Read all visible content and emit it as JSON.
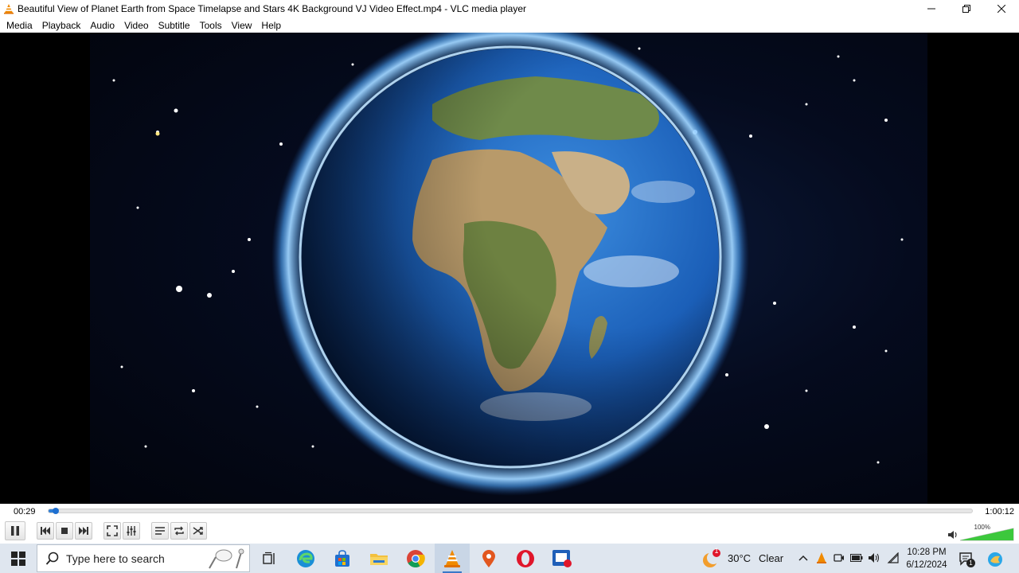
{
  "window": {
    "title": "Beautiful View of Planet Earth from Space Timelapse and Stars 4K Background VJ Video Effect.mp4 - VLC media player",
    "app_icon": "vlc-cone-icon",
    "controls": [
      "minimize-icon",
      "maximize-icon",
      "close-icon"
    ]
  },
  "menu": {
    "items": [
      "Media",
      "Playback",
      "Audio",
      "Video",
      "Subtitle",
      "Tools",
      "View",
      "Help"
    ]
  },
  "video": {
    "scene": "earth-from-space",
    "colors": {
      "space": "#02040c",
      "glow": "#4fa8ff",
      "ocean": "#1b5fb8",
      "land": "#b89a6a",
      "green": "#5f7d3a"
    }
  },
  "playback": {
    "elapsed": "00:29",
    "total": "1:00:12",
    "progress": 0.008,
    "accent": "#2f7fd6"
  },
  "controls": {
    "buttons": [
      "pause-icon",
      "previous-icon",
      "stop-icon",
      "next-icon",
      "fullscreen-icon",
      "extended-settings-icon",
      "playlist-icon",
      "loop-icon",
      "shuffle-icon"
    ],
    "volume_label": "100%",
    "volume": 1.0,
    "volume_color": "#3cc83c"
  },
  "taskbar": {
    "search_placeholder": "Type here to search",
    "apps": [
      "task-view-icon",
      "edge-icon",
      "store-icon",
      "file-explorer-icon",
      "chrome-icon",
      "vlc-icon",
      "maps-pin-icon",
      "opera-icon",
      "screen-recorder-icon"
    ],
    "weather": {
      "badge": "1",
      "temperature": "30°C",
      "condition": "Clear"
    },
    "clock": {
      "time": "10:28 PM",
      "date": "6/12/2024"
    },
    "notification_count": "1"
  }
}
